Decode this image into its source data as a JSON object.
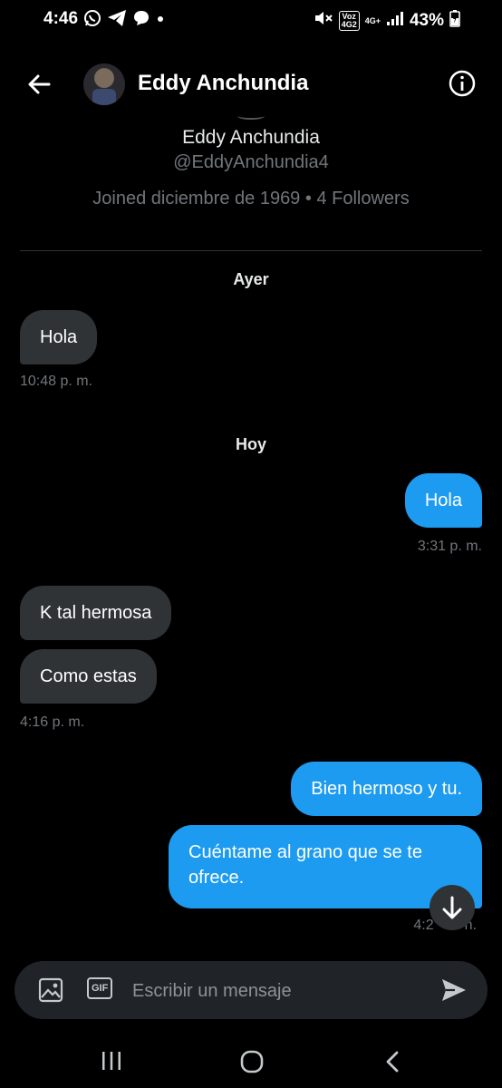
{
  "status_bar": {
    "time": "4:46",
    "network_label_top": "Voz",
    "network_label_bottom": "4G2",
    "network_gen": "4G+",
    "battery": "43%"
  },
  "header": {
    "name": "Eddy Anchundia",
    "back_icon": "arrow-left-icon",
    "info_icon": "info-icon"
  },
  "profile": {
    "name": "Eddy Anchundia",
    "handle": "@EddyAnchundia4",
    "joined": "Joined diciembre de 1969",
    "separator": "•",
    "followers": "4 Followers"
  },
  "conversation": {
    "day_yesterday": "Ayer",
    "day_today": "Hoy",
    "messages": [
      {
        "direction": "in",
        "text": "Hola"
      },
      {
        "direction": "out",
        "text": "Hola"
      },
      {
        "direction": "in",
        "text": "K tal hermosa"
      },
      {
        "direction": "in",
        "text": "Como estas"
      },
      {
        "direction": "out",
        "text": "Bien hermoso y tu."
      },
      {
        "direction": "out",
        "text": "Cuéntame al grano que se te ofrece."
      }
    ],
    "timestamps": {
      "t1": "10:48 p. m.",
      "t2": "3:31 p. m.",
      "t3": "4:16 p. m.",
      "t4": "4:2",
      "t4_tail": "n."
    }
  },
  "composer": {
    "placeholder": "Escribir un mensaje",
    "gif_label": "GIF",
    "image_icon": "image-icon",
    "send_icon": "send-icon"
  },
  "colors": {
    "background": "#000000",
    "incoming_bubble": "#2f3336",
    "outgoing_bubble": "#1d9bf0",
    "muted_text": "#71767b"
  }
}
